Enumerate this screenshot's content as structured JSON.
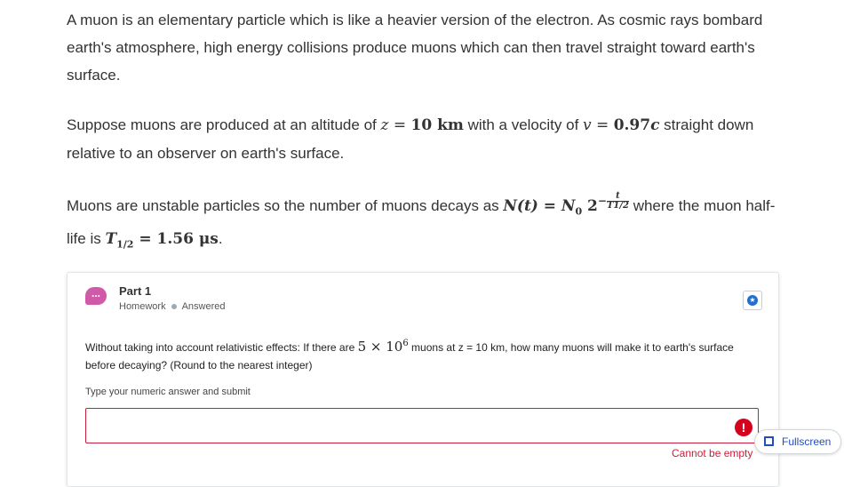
{
  "intro": {
    "p1": "A muon is an elementary particle which is like a heavier version of the electron. As cosmic rays bombard earth's atmosphere, high energy collisions produce muons which can then travel straight toward earth's surface.",
    "p2_a": "Suppose muons are produced at an altitude of ",
    "p2_z": "z",
    "p2_eq1": " = ",
    "p2_zval": "10 km",
    "p2_b": " with a velocity of ",
    "p2_v": "v",
    "p2_eq2": " = ",
    "p2_vval": "0.97",
    "p2_c": "c",
    "p2_end": " straight down relative to an observer on earth's surface.",
    "p3_a": "Muons are unstable particles so the number of muons decays as ",
    "p3_formula_lhs": "N(t) = N",
    "p3_formula_sub": "0",
    "p3_formula_base": " 2",
    "p3_exp_minus": "−",
    "p3_exp_num": "t",
    "p3_exp_den": "T1/2",
    "p3_b": " where the muon half-life is ",
    "p3_T": "T",
    "p3_Tsub": "1/2",
    "p3_Tval": " = 1.56 μs",
    "p3_end": "."
  },
  "part": {
    "title": "Part 1",
    "category": "Homework",
    "status": "Answered",
    "icon_glyph": "...",
    "question_a": "Without taking into account relativistic effects: If there are ",
    "question_math": "5 × 10",
    "question_exp": "6",
    "question_b": " muons at z = 10 km, how many muons will make it to earth's surface before decaying? (Round to the nearest integer)",
    "answer_label": "Type your numeric answer and submit",
    "answer_value": "",
    "error_glyph": "!",
    "error_message": "Cannot be empty"
  },
  "fullscreen_label": "Fullscreen",
  "colors": {
    "accent": "#1f6fd1",
    "error": "#c81e3a",
    "part_icon": "#d15aa8"
  }
}
